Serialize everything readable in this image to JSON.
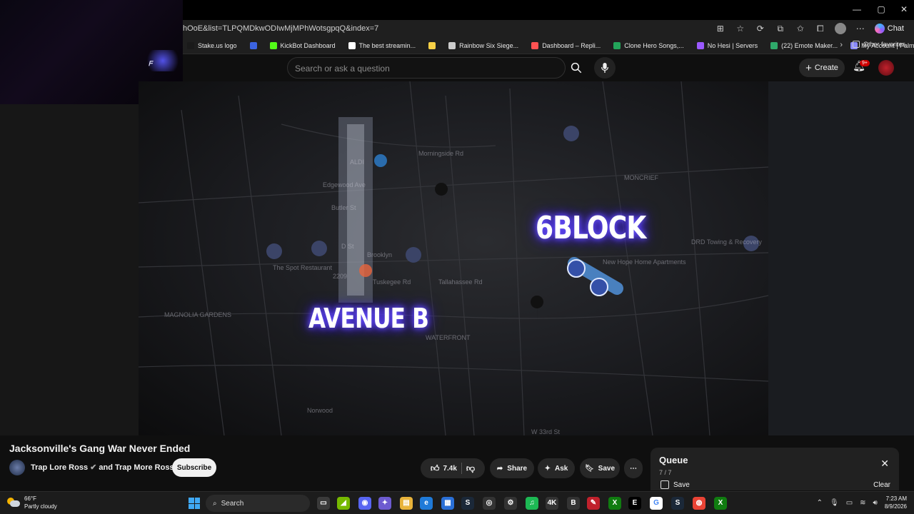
{
  "browser": {
    "url": "hOoE&list=TLPQMDkwODIwMjMPhWotsgpqQ&index=7",
    "chat_label": "Chat",
    "bookmarks": [
      {
        "label": "Stake.us logo",
        "color": "#1a1a1a"
      },
      {
        "label": "",
        "color": "#3b63e0"
      },
      {
        "label": "KickBot Dashboard",
        "color": "#53fc18"
      },
      {
        "label": "The best streamin...",
        "color": "#ffffff"
      },
      {
        "label": "",
        "color": "#f7d046"
      },
      {
        "label": "Rainbow Six Siege...",
        "color": "#cccccc"
      },
      {
        "label": "Dashboard – Repli...",
        "color": "#ff5252"
      },
      {
        "label": "Clone Hero Songs,...",
        "color": "#23a55a"
      },
      {
        "label": "No Hesi | Servers",
        "color": "#9b59ff"
      },
      {
        "label": "(22) Emote Maker...",
        "color": "#2fa86a"
      },
      {
        "label": "My Account | Palm...",
        "color": "#8a8aff"
      }
    ],
    "other_favorites": "Other favorites"
  },
  "youtube": {
    "search_placeholder": "Search or ask a question",
    "create_label": "Create",
    "notif_badge": "9+"
  },
  "video": {
    "map_overlays": {
      "label_left": "AVENUE B",
      "label_right": "6BLOCK"
    },
    "map_text": [
      {
        "text": "ALDI"
      },
      {
        "text": "Edgewood Ave"
      },
      {
        "text": "Butler St"
      },
      {
        "text": "D St"
      },
      {
        "text": "Brooklyn"
      },
      {
        "text": "The Spot Restaurant"
      },
      {
        "text": "2209"
      },
      {
        "text": "Tuskegee Rd"
      },
      {
        "text": "MAGNOLIA GARDENS"
      },
      {
        "text": "WATERFRONT"
      },
      {
        "text": "Norwood"
      },
      {
        "text": "New Hope Home Apartments"
      },
      {
        "text": "MONCRIEF"
      },
      {
        "text": "DRD Towing & Recovery"
      },
      {
        "text": "W 33rd St"
      },
      {
        "text": "Morningside Rd"
      },
      {
        "text": "Tallahassee Rd"
      }
    ]
  },
  "info": {
    "title": "Jacksonville's Gang War Never Ended",
    "channel": "Trap Lore Ross",
    "channel_suffix": "and Trap More Ross",
    "subscribe": "Subscribe",
    "likes": "7.4k",
    "share": "Share",
    "ask": "Ask",
    "save": "Save"
  },
  "queue": {
    "title": "Queue",
    "count": "7 / 7",
    "save": "Save",
    "clear": "Clear"
  },
  "taskbar": {
    "temperature": "66°F",
    "condition": "Partly cloudy",
    "search": "Search",
    "time": "7:23 AM",
    "date": "8/9/2026"
  }
}
